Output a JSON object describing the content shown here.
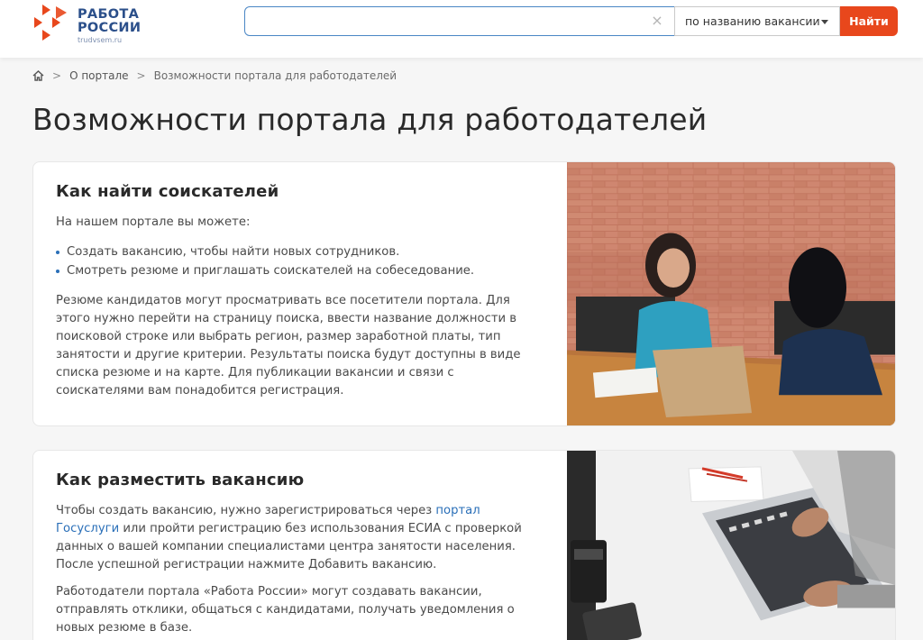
{
  "header": {
    "logo_line1": "РАБОТА",
    "logo_line2": "РОССИИ",
    "logo_domain": "trudvsem.ru",
    "search_placeholder": "",
    "search_clear": "×",
    "search_mode": "по названию вакансии",
    "search_button": "Найти"
  },
  "breadcrumb": {
    "home_icon": "home-icon",
    "separator": ">",
    "items": [
      "О портале",
      "Возможности портала для работодателей"
    ]
  },
  "page_title": "Возможности портала для работодателей",
  "cards": [
    {
      "title": "Как найти соискателей",
      "intro": "На нашем портале вы можете:",
      "bullets": [
        "Создать вакансию, чтобы найти новых сотрудников.",
        "Смотреть резюме и приглашать соискателей на собеседование."
      ],
      "paragraph_lines": [
        "Резюме кандидатов могут просматривать все посетители портала. Для",
        "этого нужно перейти на страницу поиска, ввести название должности в",
        "поисковой строке или выбрать регион, размер заработной платы, тип",
        "занятости и другие критерии. Результаты поиска будут доступны в виде",
        "списка резюме и на карте. Для публикации вакансии и связи с",
        "соискателями вам понадобится регистрация."
      ]
    },
    {
      "title": "Как разместить вакансию",
      "p1_line1_start": "Чтобы создать вакансию, нужно зарегистрироваться через ",
      "p1_link_part1": "портал",
      "p1_link_part2": "Госуслуги",
      "p1_line2_rest": " или пройти регистрацию без использования ЕСИА с проверкой",
      "p1_line3": "данных о вашей компании специалистами центра занятости населения.",
      "p1_line4": "После успешной регистрации нажмите Добавить вакансию.",
      "p2_lines": [
        "Работодатели портала «Работа России» могут создавать вакансии,",
        "отправлять отклики, общаться с кандидатами, получать уведомления о",
        "новых резюме в базе."
      ]
    }
  ],
  "colors": {
    "brand_blue": "#2b4f8a",
    "accent_orange": "#e8471c",
    "link_blue": "#2a6fb8"
  }
}
